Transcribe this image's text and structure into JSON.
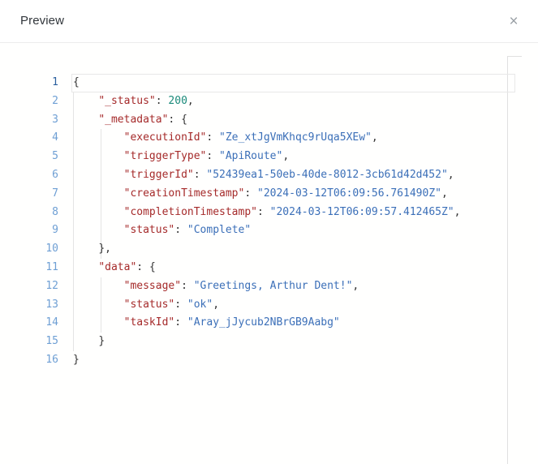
{
  "header": {
    "title": "Preview",
    "close_label": "×",
    "close_icon": "close-icon"
  },
  "editor": {
    "language": "json",
    "active_line": 1,
    "total_lines": 16,
    "colors": {
      "key": "#a52a2a",
      "string": "#3b6fb8",
      "number": "#1a8a7a",
      "punctuation": "#333333",
      "gutter": "#6e9fd4",
      "gutter_active": "#2b5f9e",
      "background": "#fffffe",
      "indent_guide": "#e4e4e4"
    },
    "lines": [
      {
        "n": "1",
        "indent": 0,
        "tokens": [
          {
            "t": "brace",
            "v": "{"
          }
        ]
      },
      {
        "n": "2",
        "indent": 1,
        "tokens": [
          {
            "t": "key",
            "v": "\"_status\""
          },
          {
            "t": "punct",
            "v": ": "
          },
          {
            "t": "num",
            "v": "200"
          },
          {
            "t": "punct",
            "v": ","
          }
        ]
      },
      {
        "n": "3",
        "indent": 1,
        "tokens": [
          {
            "t": "key",
            "v": "\"_metadata\""
          },
          {
            "t": "punct",
            "v": ": "
          },
          {
            "t": "brace",
            "v": "{"
          }
        ]
      },
      {
        "n": "4",
        "indent": 2,
        "tokens": [
          {
            "t": "key",
            "v": "\"executionId\""
          },
          {
            "t": "punct",
            "v": ": "
          },
          {
            "t": "str",
            "v": "\"Ze_xtJgVmKhqc9rUqa5XEw\""
          },
          {
            "t": "punct",
            "v": ","
          }
        ]
      },
      {
        "n": "5",
        "indent": 2,
        "tokens": [
          {
            "t": "key",
            "v": "\"triggerType\""
          },
          {
            "t": "punct",
            "v": ": "
          },
          {
            "t": "str",
            "v": "\"ApiRoute\""
          },
          {
            "t": "punct",
            "v": ","
          }
        ]
      },
      {
        "n": "6",
        "indent": 2,
        "tokens": [
          {
            "t": "key",
            "v": "\"triggerId\""
          },
          {
            "t": "punct",
            "v": ": "
          },
          {
            "t": "str",
            "v": "\"52439ea1-50eb-40de-8012-3cb61d42d452\""
          },
          {
            "t": "punct",
            "v": ","
          }
        ]
      },
      {
        "n": "7",
        "indent": 2,
        "tokens": [
          {
            "t": "key",
            "v": "\"creationTimestamp\""
          },
          {
            "t": "punct",
            "v": ": "
          },
          {
            "t": "str",
            "v": "\"2024-03-12T06:09:56.761490Z\""
          },
          {
            "t": "punct",
            "v": ","
          }
        ]
      },
      {
        "n": "8",
        "indent": 2,
        "tokens": [
          {
            "t": "key",
            "v": "\"completionTimestamp\""
          },
          {
            "t": "punct",
            "v": ": "
          },
          {
            "t": "str",
            "v": "\"2024-03-12T06:09:57.412465Z\""
          },
          {
            "t": "punct",
            "v": ","
          }
        ]
      },
      {
        "n": "9",
        "indent": 2,
        "tokens": [
          {
            "t": "key",
            "v": "\"status\""
          },
          {
            "t": "punct",
            "v": ": "
          },
          {
            "t": "str",
            "v": "\"Complete\""
          }
        ]
      },
      {
        "n": "10",
        "indent": 1,
        "tokens": [
          {
            "t": "brace",
            "v": "}"
          },
          {
            "t": "punct",
            "v": ","
          }
        ]
      },
      {
        "n": "11",
        "indent": 1,
        "tokens": [
          {
            "t": "key",
            "v": "\"data\""
          },
          {
            "t": "punct",
            "v": ": "
          },
          {
            "t": "brace",
            "v": "{"
          }
        ]
      },
      {
        "n": "12",
        "indent": 2,
        "tokens": [
          {
            "t": "key",
            "v": "\"message\""
          },
          {
            "t": "punct",
            "v": ": "
          },
          {
            "t": "str",
            "v": "\"Greetings, Arthur Dent!\""
          },
          {
            "t": "punct",
            "v": ","
          }
        ]
      },
      {
        "n": "13",
        "indent": 2,
        "tokens": [
          {
            "t": "key",
            "v": "\"status\""
          },
          {
            "t": "punct",
            "v": ": "
          },
          {
            "t": "str",
            "v": "\"ok\""
          },
          {
            "t": "punct",
            "v": ","
          }
        ]
      },
      {
        "n": "14",
        "indent": 2,
        "tokens": [
          {
            "t": "key",
            "v": "\"taskId\""
          },
          {
            "t": "punct",
            "v": ": "
          },
          {
            "t": "str",
            "v": "\"Aray_jJycub2NBrGB9Aabg\""
          }
        ]
      },
      {
        "n": "15",
        "indent": 1,
        "tokens": [
          {
            "t": "brace",
            "v": "}"
          }
        ]
      },
      {
        "n": "16",
        "indent": 0,
        "tokens": [
          {
            "t": "brace",
            "v": "}"
          }
        ]
      }
    ]
  }
}
